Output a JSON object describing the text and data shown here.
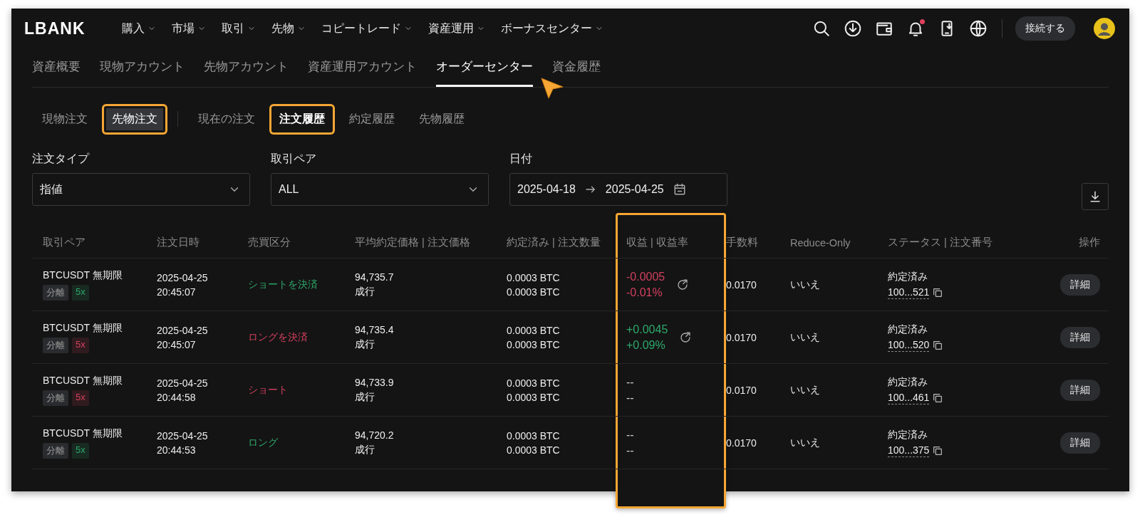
{
  "logo": "LBANK",
  "nav": [
    {
      "label": "購入"
    },
    {
      "label": "市場"
    },
    {
      "label": "取引"
    },
    {
      "label": "先物"
    },
    {
      "label": "コピートレード"
    },
    {
      "label": "資産運用"
    },
    {
      "label": "ボーナスセンター"
    }
  ],
  "notification_unread": true,
  "connect_button": "接続する",
  "account_tabs": [
    {
      "label": "資産概要",
      "selected": false
    },
    {
      "label": "現物アカウント",
      "selected": false
    },
    {
      "label": "先物アカウント",
      "selected": false
    },
    {
      "label": "資産運用アカウント",
      "selected": false
    },
    {
      "label": "オーダーセンター",
      "selected": true
    },
    {
      "label": "資金履歴",
      "selected": false
    }
  ],
  "order_tabs": [
    {
      "label": "現物注文",
      "selected": false,
      "highlighted": false
    },
    {
      "label": "先物注文",
      "selected": true,
      "highlighted": true
    }
  ],
  "history_tabs": [
    {
      "label": "現在の注文",
      "selected": false,
      "highlighted": false
    },
    {
      "label": "注文履歴",
      "selected": true,
      "highlighted": true
    },
    {
      "label": "約定履歴",
      "selected": false,
      "highlighted": false
    },
    {
      "label": "先物履歴",
      "selected": false,
      "highlighted": false
    }
  ],
  "filters": [
    {
      "kind": "select",
      "label": "注文タイプ",
      "value": "指値"
    },
    {
      "kind": "select",
      "label": "取引ペア",
      "value": "ALL"
    },
    {
      "kind": "daterange",
      "label": "日付",
      "start": "2025-04-18",
      "end": "2025-04-25"
    }
  ],
  "table": {
    "columns": [
      {
        "label": "取引ペア",
        "highlighted": false
      },
      {
        "label": "注文日時",
        "highlighted": false
      },
      {
        "label": "売買区分",
        "highlighted": false
      },
      {
        "label": "平均約定価格 | 注文価格",
        "highlighted": false
      },
      {
        "label": "約定済み | 注文数量",
        "highlighted": false
      },
      {
        "label": "収益 | 収益率",
        "highlighted": true
      },
      {
        "label": "手数料",
        "highlighted": false
      },
      {
        "label": "Reduce-Only",
        "highlighted": false
      },
      {
        "label": "ステータス | 注文番号",
        "highlighted": false
      },
      {
        "label": "操作",
        "highlighted": false
      }
    ],
    "rows": [
      {
        "pair": "BTCUSDT 無期限",
        "margin": "分離",
        "leverage": "5x",
        "color": "#2ea86b",
        "date": "2025-04-25",
        "time": "20:45:07",
        "side": "ショートを決済",
        "avg_price": "94,735.7",
        "order_price": "成行",
        "filled": "0.0003 BTC",
        "quantity": "0.0003 BTC",
        "pnl": {
          "value": "-0.0005",
          "rate": "-0.01%",
          "color": "#d2405e"
        },
        "share": true,
        "fee": "0.0170",
        "reduce_only": "いいえ",
        "status": "約定済み",
        "order_no": "100...521",
        "action": "詳細"
      },
      {
        "pair": "BTCUSDT 無期限",
        "margin": "分離",
        "leverage": "5x",
        "color": "#d2405e",
        "date": "2025-04-25",
        "time": "20:45:07",
        "side": "ロングを決済",
        "avg_price": "94,735.4",
        "order_price": "成行",
        "filled": "0.0003 BTC",
        "quantity": "0.0003 BTC",
        "pnl": {
          "value": "+0.0045",
          "rate": "+0.09%",
          "color": "#2ea86b"
        },
        "share": true,
        "fee": "0.0170",
        "reduce_only": "いいえ",
        "status": "約定済み",
        "order_no": "100...520",
        "action": "詳細"
      },
      {
        "pair": "BTCUSDT 無期限",
        "margin": "分離",
        "leverage": "5x",
        "color": "#d2405e",
        "date": "2025-04-25",
        "time": "20:44:58",
        "side": "ショート",
        "avg_price": "94,733.9",
        "order_price": "成行",
        "filled": "0.0003 BTC",
        "quantity": "0.0003 BTC",
        "pnl": {
          "value": "--",
          "rate": "--",
          "color": "#cccccc"
        },
        "share": false,
        "fee": "0.0170",
        "reduce_only": "いいえ",
        "status": "約定済み",
        "order_no": "100...461",
        "action": "詳細"
      },
      {
        "pair": "BTCUSDT 無期限",
        "margin": "分離",
        "leverage": "5x",
        "color": "#2ea86b",
        "date": "2025-04-25",
        "time": "20:44:53",
        "side": "ロング",
        "avg_price": "94,720.2",
        "order_price": "成行",
        "filled": "0.0003 BTC",
        "quantity": "0.0003 BTC",
        "pnl": {
          "value": "--",
          "rate": "--",
          "color": "#cccccc"
        },
        "share": false,
        "fee": "0.0170",
        "reduce_only": "いいえ",
        "status": "約定済み",
        "order_no": "100...375",
        "action": "詳細"
      }
    ]
  }
}
